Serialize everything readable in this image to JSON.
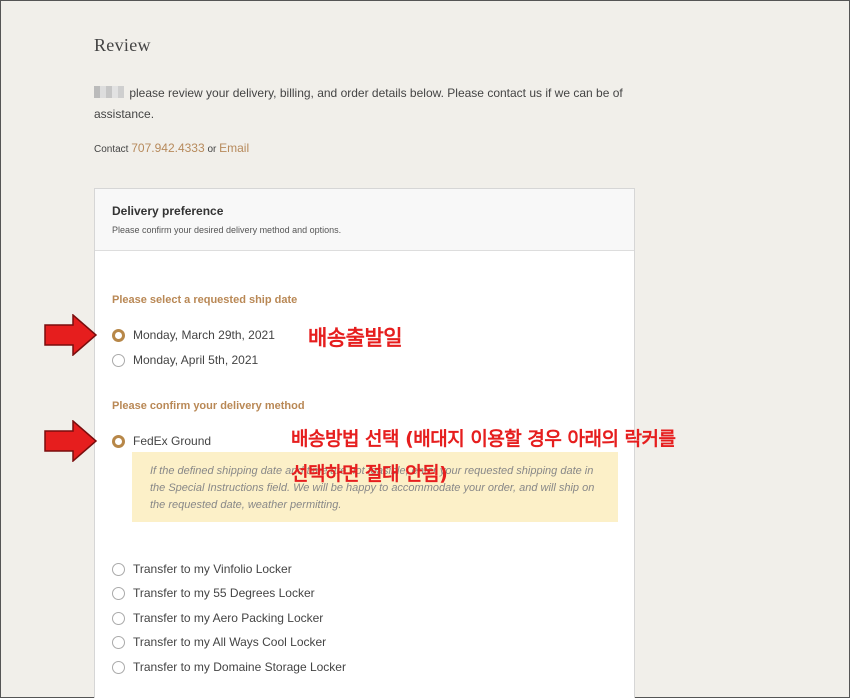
{
  "page": {
    "title": "Review",
    "intro": "please review your delivery, billing, and order details below. Please contact us if we can be of assistance.",
    "contact_label": "Contact",
    "phone": "707.942.4333",
    "or_text": "or",
    "email_label": "Email"
  },
  "card": {
    "title": "Delivery preference",
    "subtitle": "Please confirm your desired delivery method and options."
  },
  "ship_date": {
    "label": "Please select a requested ship date",
    "options": [
      {
        "label": "Monday, March 29th, 2021",
        "checked": true
      },
      {
        "label": "Monday, April 5th, 2021",
        "checked": false
      }
    ]
  },
  "delivery_method": {
    "label": "Please confirm your delivery method",
    "fedex": {
      "label": "FedEx Ground",
      "checked": true
    },
    "note": "If the defined shipping date and time are not feasible, enter your requested shipping date in the Special Instructions field. We will be happy to accommodate your order, and will ship on the requested date, weather permitting.",
    "lockers": [
      {
        "label": "Transfer to my Vinfolio Locker",
        "checked": false
      },
      {
        "label": "Transfer to my 55 Degrees Locker",
        "checked": false
      },
      {
        "label": "Transfer to my Aero Packing Locker",
        "checked": false
      },
      {
        "label": "Transfer to my All Ways Cool Locker",
        "checked": false
      },
      {
        "label": "Transfer to my Domaine Storage Locker",
        "checked": false
      }
    ]
  },
  "annotations": {
    "ship_date": "배송출발일",
    "method_line1": "배송방법 선택 (배대지 이용할 경우 아래의 락커를",
    "method_line2": "선택하면 절대 안됨)"
  },
  "colors": {
    "accent": "#b98855",
    "annotation": "#e61e1e",
    "note_bg": "#fcf0c8"
  }
}
